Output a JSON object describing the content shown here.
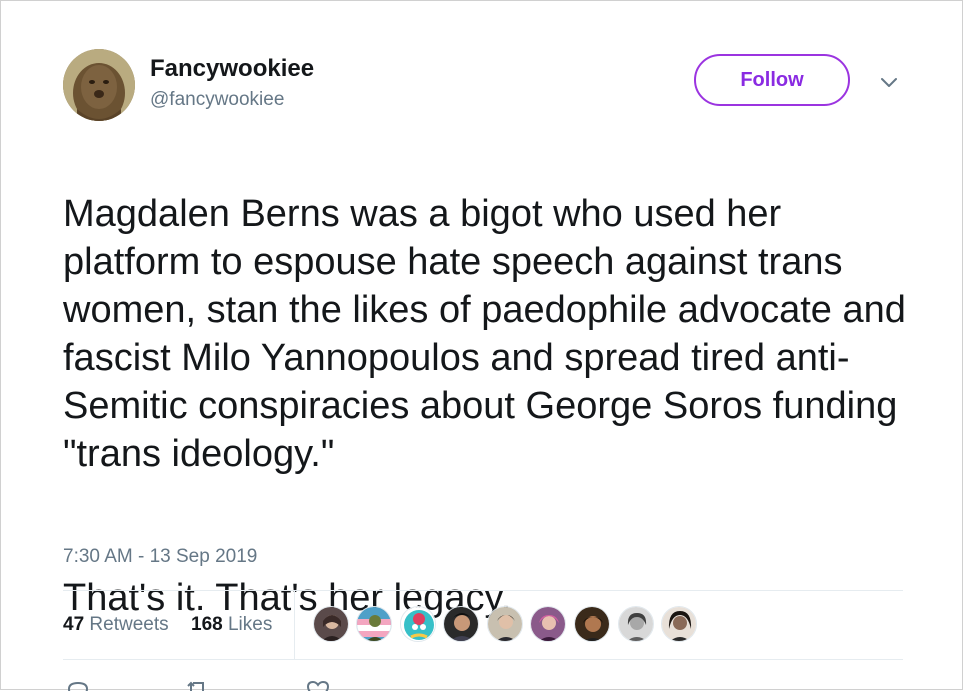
{
  "author": {
    "display_name": "Fancywookiee",
    "handle": "@fancywookiee",
    "avatar_icon": "wookiee-avatar"
  },
  "follow_label": "Follow",
  "caret_icon": "chevron-down-icon",
  "tweet": {
    "paragraph_1": "Magdalen Berns was a bigot who used her platform to espouse hate speech against trans women, stan the likes of paedophile advocate and fascist Milo Yannopoulos and spread tired anti-Semitic conspiracies about George Soros funding \"trans ideology.\"",
    "paragraph_2": "That's it. That's her legacy."
  },
  "timestamp": "7:30 AM - 13 Sep 2019",
  "stats": {
    "retweets_count": "47",
    "retweets_label": "Retweets",
    "likes_count": "168",
    "likes_label": "Likes"
  },
  "liker_avatars": [
    "avatar-1",
    "avatar-2",
    "avatar-3",
    "avatar-4",
    "avatar-5",
    "avatar-6",
    "avatar-7",
    "avatar-8",
    "avatar-9"
  ],
  "actions": [
    "reply-icon",
    "retweet-icon",
    "like-icon"
  ],
  "colors": {
    "follow_accent": "#9b34e0",
    "secondary_text": "#657786",
    "primary_text": "#14171a",
    "divider": "#e6ecf0"
  }
}
